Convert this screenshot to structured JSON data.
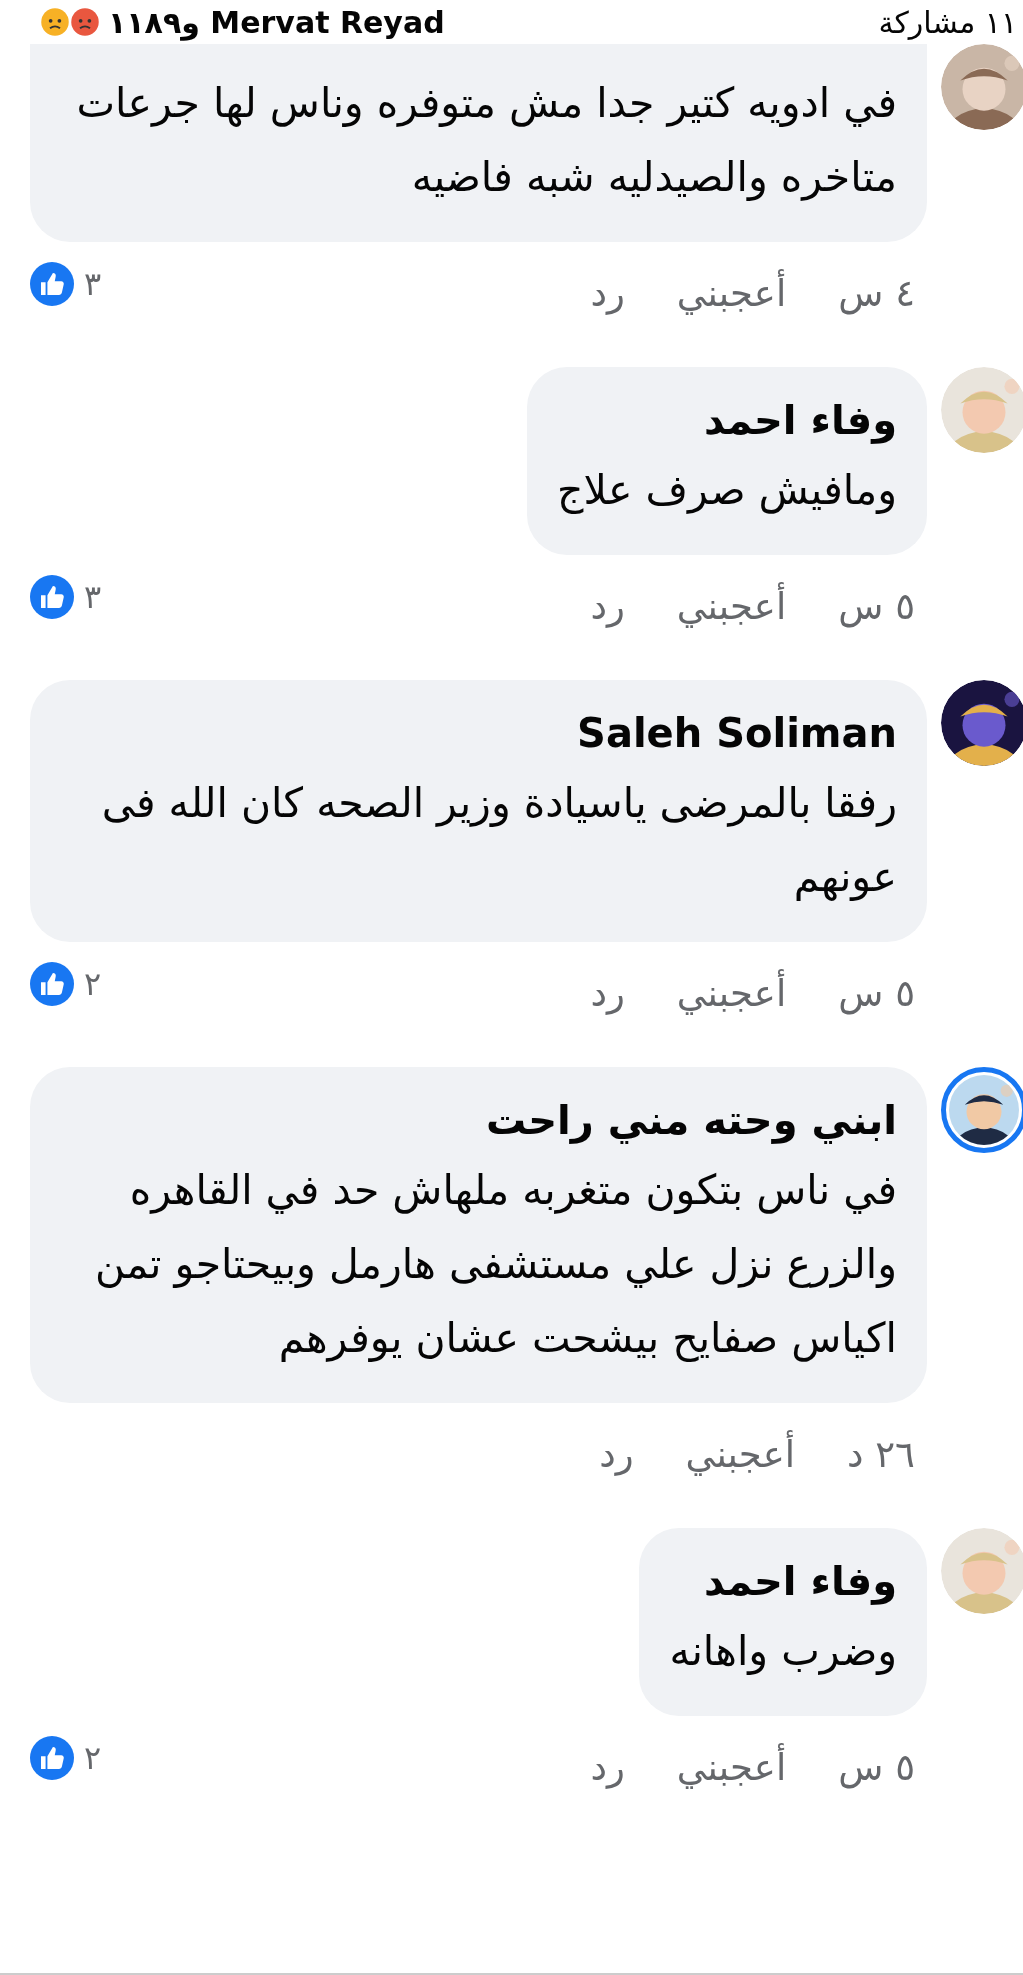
{
  "header": {
    "shares": "١١ مشاركة",
    "reactors": "Mervat Reyad و١١٨٩"
  },
  "comments": [
    {
      "text": "في ادويه كتير جدا مش متوفره وناس لها جرعات متاخره والصيدليه شبه فاضيه",
      "time": "٤ س",
      "like": "أعجبني",
      "reply": "رد",
      "reactions": "٣",
      "story_ring": false
    },
    {
      "name": "وفاء احمد",
      "text": "ومافيش صرف علاج",
      "time": "٥ س",
      "like": "أعجبني",
      "reply": "رد",
      "reactions": "٣",
      "story_ring": false
    },
    {
      "name": "Saleh Soliman",
      "text": "رفقا بالمرضى ياسيادة وزير الصحه كان الله فى عونهم",
      "time": "٥ س",
      "like": "أعجبني",
      "reply": "رد",
      "reactions": "٢",
      "story_ring": false
    },
    {
      "name": "ابني وحته مني راحت",
      "text": "في ناس بتكون متغربه ملهاش حد في القاهره والزرع نزل علي مستشفى هارمل وبيحتاجو تمن اكياس صفايح بيشحت عشان يوفرهم",
      "time": "٢٦ د",
      "like": "أعجبني",
      "reply": "رد",
      "story_ring": true
    },
    {
      "name": "وفاء احمد",
      "text": "وضرب واهانه",
      "time": "٥ س",
      "like": "أعجبني",
      "reply": "رد",
      "reactions": "٢",
      "story_ring": false
    }
  ]
}
